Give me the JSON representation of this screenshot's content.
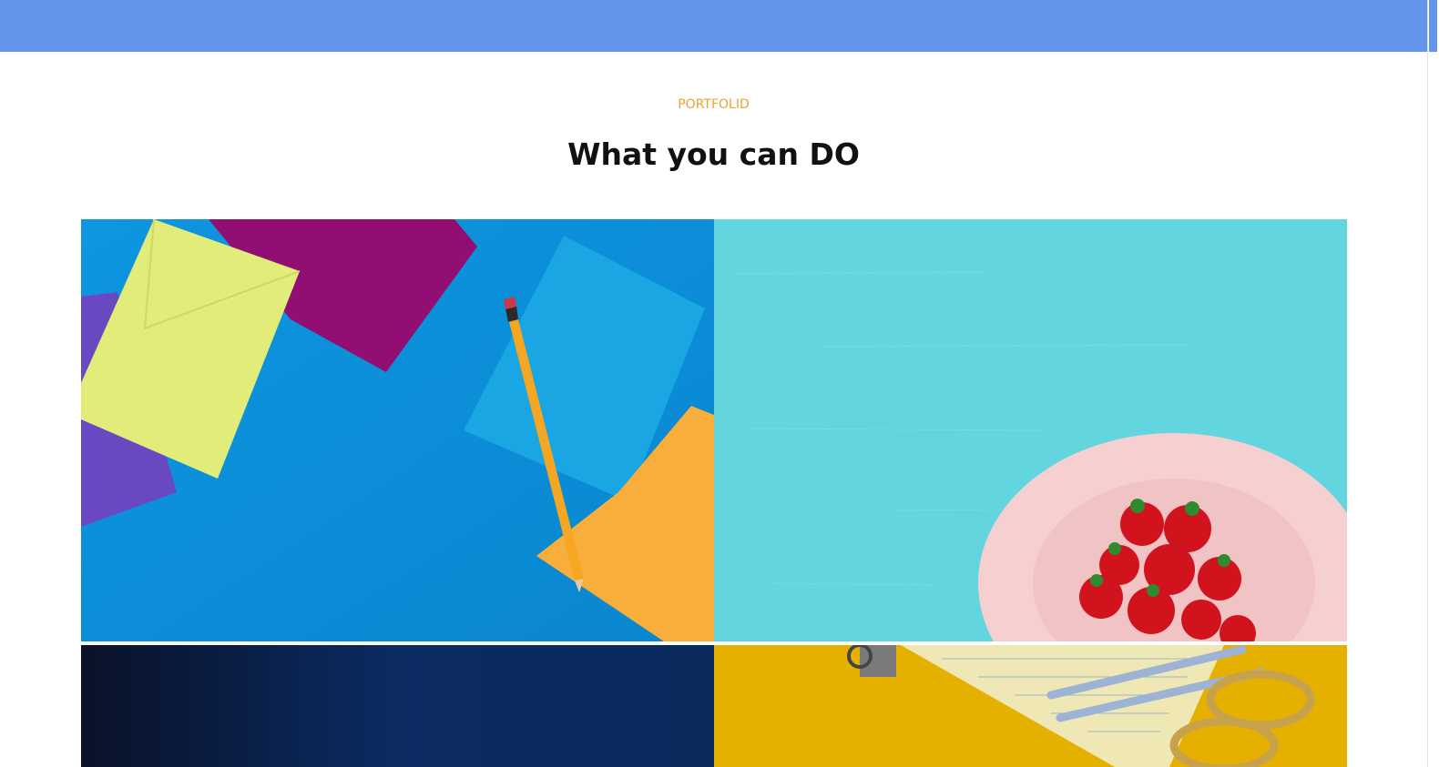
{
  "header": {
    "bar_color": "#6494ec"
  },
  "section": {
    "eyebrow": "PORTFOLID",
    "eyebrow_color": "#f0a030",
    "title": "What you can DO"
  },
  "portfolio": {
    "items": [
      {
        "subject": "envelopes-and-pencil",
        "background": "#0a8fd8"
      },
      {
        "subject": "strawberries-on-plate",
        "background": "#5fd6e0"
      },
      {
        "subject": "dark-blue-texture",
        "background": "#0b2a5a"
      },
      {
        "subject": "stationery-on-yellow",
        "background": "#e6b000"
      }
    ]
  }
}
